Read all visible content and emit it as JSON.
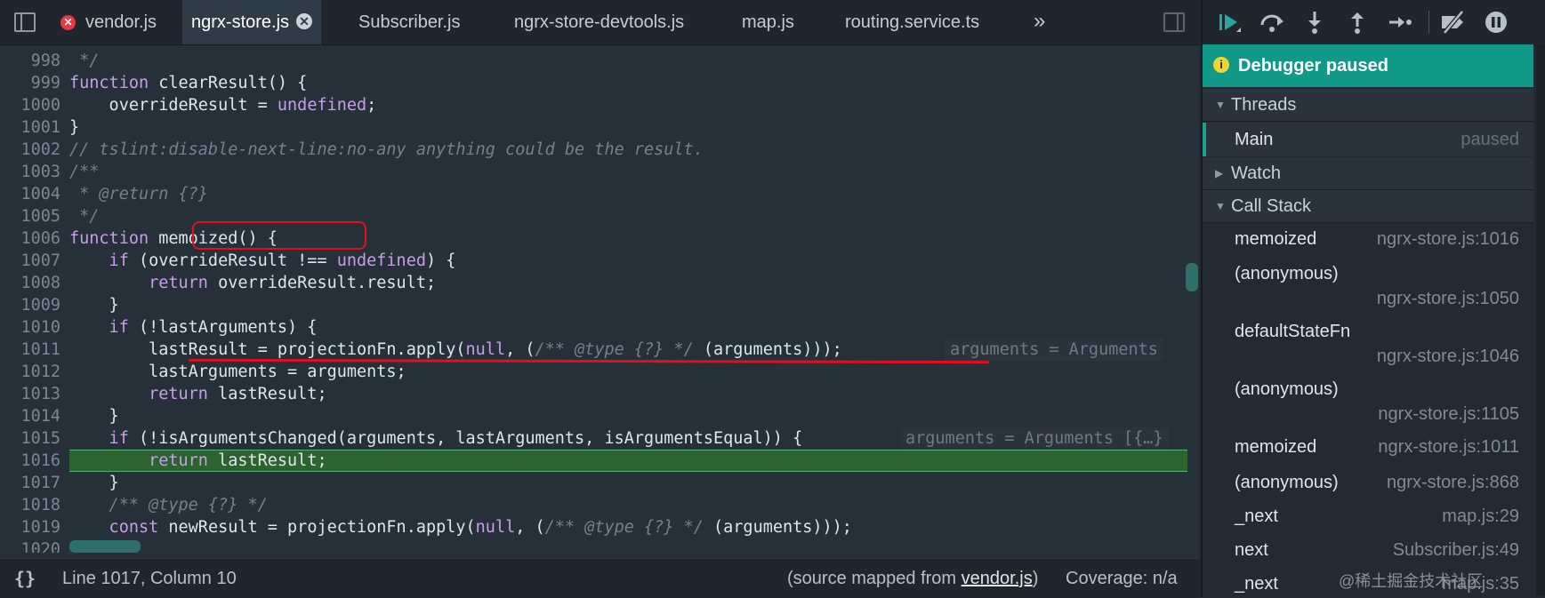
{
  "tabs": [
    {
      "label": "vendor.js",
      "has_error": true
    },
    {
      "label": "ngrx-store.js",
      "active": true
    },
    {
      "label": "Subscriber.js"
    },
    {
      "label": "ngrx-store-devtools.js"
    },
    {
      "label": "map.js"
    },
    {
      "label": "routing.service.ts"
    }
  ],
  "more_tabs": "»",
  "close_tab": "✕",
  "error_icon": "✕",
  "code_lines": {
    "l998": {
      "num": "998",
      "text": " */"
    },
    "l999": {
      "num": "999",
      "kw": "function",
      "rest": " clearResult() {"
    },
    "l1000": {
      "num": "1000",
      "a": "    overrideResult = ",
      "b": "undefined",
      "c": ";"
    },
    "l1001": {
      "num": "1001",
      "text": "}"
    },
    "l1002": {
      "num": "1002",
      "text": "// tslint:disable-next-line:no-any anything could be the result."
    },
    "l1003": {
      "num": "1003",
      "text": "/**"
    },
    "l1004": {
      "num": "1004",
      "text": " * @return {?}"
    },
    "l1005": {
      "num": "1005",
      "text": " */"
    },
    "l1006": {
      "num": "1006",
      "kw": "function",
      "rest": " memoized() {"
    },
    "l1007": {
      "num": "1007",
      "kw": "    if",
      "a": " (overrideResult !== ",
      "b": "undefined",
      "c": ") {"
    },
    "l1008": {
      "num": "1008",
      "kw": "        return",
      "rest": " overrideResult.result;"
    },
    "l1009": {
      "num": "1009",
      "text": "    }"
    },
    "l1010": {
      "num": "1010",
      "kw": "    if",
      "rest": " (!lastArguments) {"
    },
    "l1011": {
      "num": "1011",
      "a": "        lastResult = projectionFn.apply(",
      "b": "null",
      "c": ", (",
      "d": "/** @type {?} */",
      "e": " (arguments)));",
      "inline": "arguments = Arguments"
    },
    "l1012": {
      "num": "1012",
      "text": "        lastArguments = arguments;"
    },
    "l1013": {
      "num": "1013",
      "kw": "        return",
      "rest": " lastResult;"
    },
    "l1014": {
      "num": "1014",
      "text": "    }"
    },
    "l1015": {
      "num": "1015",
      "kw": "    if",
      "rest": " (!isArgumentsChanged(arguments, lastArguments, isArgumentsEqual)) {",
      "inline": "arguments = Arguments [{…}"
    },
    "l1016": {
      "num": "1016",
      "kw": "        return",
      "rest": " lastResult;"
    },
    "l1017": {
      "num": "1017",
      "text": "    }"
    },
    "l1018": {
      "num": "1018",
      "text": "    /** @type {?} */"
    },
    "l1019": {
      "num": "1019",
      "kw": "    const",
      "a": " newResult = projectionFn.apply(",
      "b": "null",
      "c": ", (",
      "d": "/** @type {?} */",
      "e": " (arguments)));"
    },
    "l1020": {
      "num": "1020"
    }
  },
  "status": {
    "braces": "{}",
    "cursor": "Line 1017, Column 10",
    "mapped_prefix": "(source mapped from ",
    "mapped_link": "vendor.js",
    "mapped_suffix": ")",
    "coverage": "Coverage: n/a"
  },
  "debugger": {
    "toolbar": [
      "resume-icon",
      "step-over-icon",
      "step-into-icon",
      "step-out-icon",
      "step-icon",
      "deactivate-breakpoints-icon",
      "pause-on-exceptions-icon"
    ],
    "paused_banner": "Debugger paused",
    "info_glyph": "i",
    "threads_label": "Threads",
    "thread_main": "Main",
    "thread_status": "paused",
    "watch_label": "Watch",
    "callstack_label": "Call Stack",
    "frames": [
      {
        "name": "memoized",
        "loc": "ngrx-store.js:1016"
      },
      {
        "name": "(anonymous)",
        "loc": "ngrx-store.js:1050"
      },
      {
        "name": "defaultStateFn",
        "loc": "ngrx-store.js:1046"
      },
      {
        "name": "(anonymous)",
        "loc": "ngrx-store.js:1105"
      },
      {
        "name": "memoized",
        "loc": "ngrx-store.js:1011"
      },
      {
        "name": "(anonymous)",
        "loc": "ngrx-store.js:868"
      },
      {
        "name": "_next",
        "loc": "map.js:29"
      },
      {
        "name": "next",
        "loc": "Subscriber.js:49"
      },
      {
        "name": "_next",
        "loc": "map.js:35"
      }
    ]
  },
  "watermark": "@稀土掘金技术社区",
  "colors": {
    "accent": "#0f9986",
    "exec_line": "#2d6330",
    "annotation": "#e0101f"
  }
}
